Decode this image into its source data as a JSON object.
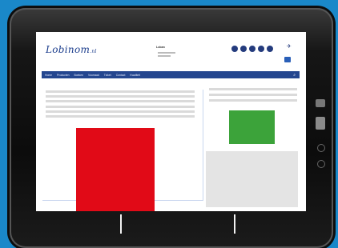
{
  "site": {
    "logo_text": "Lobinom",
    "logo_suffix": ".nl",
    "tagline": "Loban"
  },
  "nav": {
    "items": [
      "Home",
      "Producten",
      "Boeken",
      "Voorraad",
      "Ticket",
      "Contact",
      "Kwaliteit"
    ],
    "search_icon": "search-icon"
  },
  "colors": {
    "background": "#1a88c9",
    "nav": "#24468f",
    "red_block": "#e10a17",
    "green_block": "#3ca33a",
    "grey_block": "#e4e4e4"
  }
}
